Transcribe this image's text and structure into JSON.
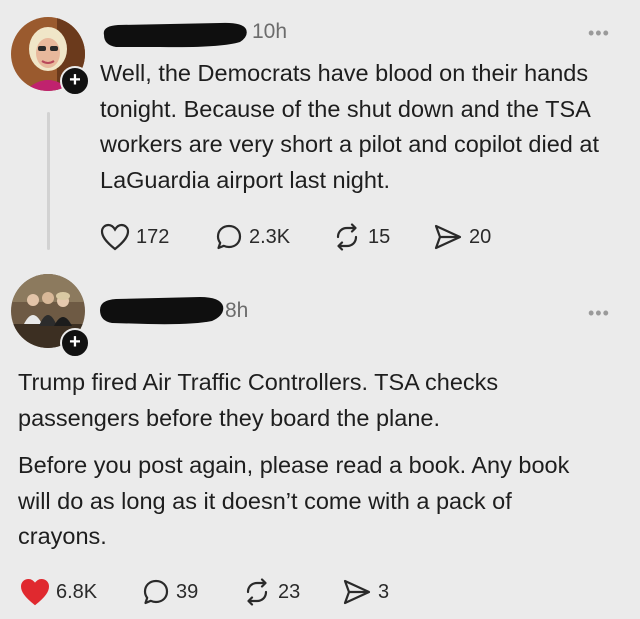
{
  "colors": {
    "background": "#ebebeb",
    "text": "#1e1e1e",
    "muted": "#6c6c6c",
    "liked_red": "#e0292f"
  },
  "posts": [
    {
      "time": "10h",
      "text": "Well, the Democrats have blood on their hands tonight. Because of the shut down and the TSA workers are very short a pilot and copilot died at LaGuardia airport last night.",
      "liked": false,
      "counts": {
        "likes": "172",
        "replies": "2.3K",
        "reposts": "15",
        "shares": "20"
      }
    },
    {
      "time": "8h",
      "paragraphs": [
        "Trump fired Air Traffic Controllers. TSA checks passengers before they board the plane.",
        "Before you post again, please read a book. Any book will do as long as it doesn’t come with a pack of crayons."
      ],
      "liked": true,
      "counts": {
        "likes": "6.8K",
        "replies": "39",
        "reposts": "23",
        "shares": "3"
      }
    }
  ]
}
